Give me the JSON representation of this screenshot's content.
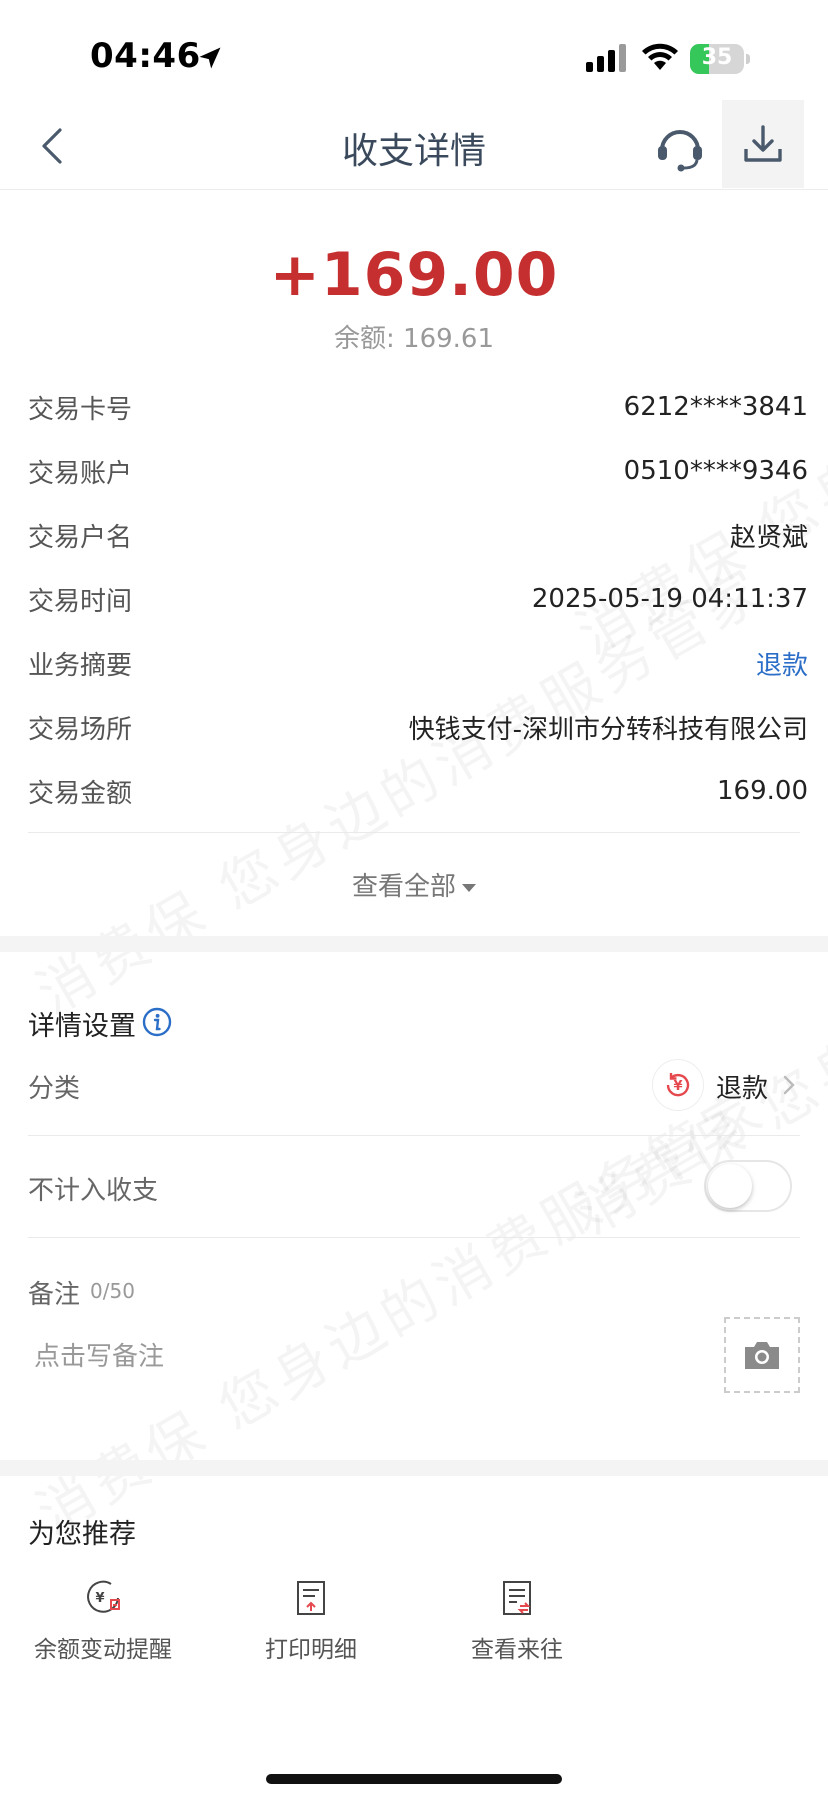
{
  "status_bar": {
    "time": "04:46",
    "battery": 35
  },
  "nav": {
    "title": "收支详情"
  },
  "summary": {
    "amount": "+169.00",
    "balance": "余额: 169.61"
  },
  "details": [
    {
      "key": "交易卡号",
      "value": "6212****3841"
    },
    {
      "key": "交易账户",
      "value": "0510****9346"
    },
    {
      "key": "交易户名",
      "value": "赵贤斌"
    },
    {
      "key": "交易时间",
      "value": "2025-05-19 04:11:37"
    },
    {
      "key": "业务摘要",
      "value": "退款"
    },
    {
      "key": "交易场所",
      "value": "快钱支付-深圳市分转科技有限公司"
    },
    {
      "key": "交易金额",
      "value": "169.00"
    }
  ],
  "view_all": "查看全部",
  "settings": {
    "title": "详情设置",
    "category_label": "分类",
    "category_value": "退款",
    "exclude_label": "不计入收支",
    "exclude_on": false,
    "note_label": "备注",
    "note_count": "0/50",
    "note_placeholder": "点击写备注"
  },
  "recommend": {
    "title": "为您推荐",
    "items": [
      {
        "label": "余额变动提醒",
        "icon": "balance-alert-icon"
      },
      {
        "label": "打印明细",
        "icon": "print-detail-icon"
      },
      {
        "label": "查看来往",
        "icon": "view-transactions-icon"
      }
    ]
  },
  "watermark": "消费保 您身边的消费服务管家",
  "colors": {
    "amount": "#c62f2f",
    "link": "#2b6ec7",
    "battery": "#35c759",
    "accent_red": "#e5484d"
  }
}
